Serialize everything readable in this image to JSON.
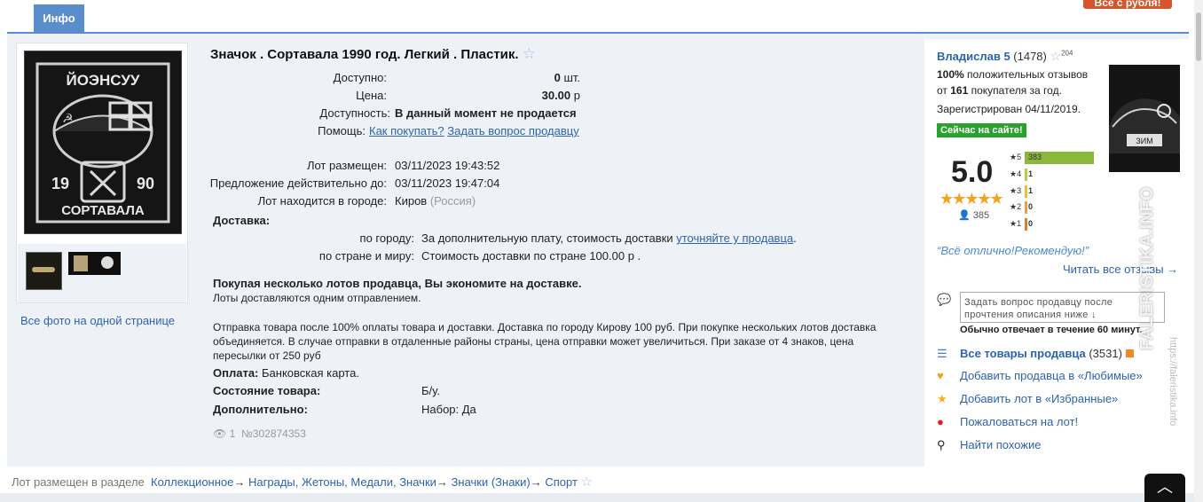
{
  "tab": {
    "label": "Инфо"
  },
  "top_button": {
    "label": "Все с рубля!"
  },
  "lot": {
    "title": "Значок . Сортавала 1990 год. Легкий . Пластик.",
    "image_badge_text": [
      "ЙОЭНСУУ",
      "19",
      "90",
      "СОРТАВАЛА"
    ],
    "all_photos_link": "Все фото на одной странице",
    "fields_top": [
      {
        "label": "Доступно:",
        "value_bold": "0",
        "value_tail": " шт."
      },
      {
        "label": "Цена:",
        "value_bold": "30.00",
        "value_tail": " р"
      }
    ],
    "availability_label": "Доступность:",
    "availability_value": "В данный момент не продается",
    "help_label": "Помощь:",
    "help_link1": "Как покупать?",
    "help_link2": "Задать вопрос продавцу",
    "fields_dates": [
      {
        "label": "Лот размещен:",
        "value": "03/11/2023 19:43:52"
      },
      {
        "label": "Предложение действительно до:",
        "value": "03/11/2023 19:47:04"
      }
    ],
    "city_label": "Лот находится в городе:",
    "city_value": "Киров",
    "city_country": " (Россия)",
    "delivery_heading": "Доставка:",
    "delivery_city_label": "по городу:",
    "delivery_city_text": "За дополнительную плату, стоимость доставки ",
    "delivery_city_link": "уточняйте у продавца",
    "delivery_country_label": "по стране и миру:",
    "delivery_country_text": "Стоимость доставки по стране 100.00 р .",
    "multi_bold": "Покупая несколько лотов продавца, Вы экономите на доставке.",
    "multi_text": "Лоты доставляются одним отправлением.",
    "shipping_note": "Отправка товара после 100% оплаты товара и доставки. Доставка по городу Кирову 100 руб. При покупке нескольких лотов доставка объединяется. В случае отправки в отдаленные районы страны, цена отправки может увеличиться. При заказе от 4 знаков, цена пересылки от 250 руб",
    "payment_label": "Оплата:",
    "payment_value": "Банковская карта.",
    "condition_label": "Состояние товара:",
    "condition_value": "Б/у.",
    "extra_label": "Дополнительно:",
    "extra_value": "Набор: Да",
    "views": "1",
    "lot_number": "№302874353"
  },
  "seller": {
    "name": "Владислав 5",
    "count": " (1478)",
    "stars_sup": "204",
    "positive_pct": "100%",
    "positive_text": " положительных отзывов",
    "buyers_prefix": "от ",
    "buyers_count": "161",
    "buyers_suffix": " покупателя за год.",
    "registered": "Зарегистрирован 04/11/2019.",
    "online": "Сейчас на сайте!",
    "rating": "5.0",
    "rating_stars": "★★★★★",
    "reviews_count": "385",
    "breakdown": [
      {
        "star": "★5",
        "count": "383",
        "fraction": 1.0,
        "color": "#8ab83a"
      },
      {
        "star": "★4",
        "count": "1",
        "fraction": 0.0,
        "color": "#b4cf3c"
      },
      {
        "star": "★3",
        "count": "1",
        "fraction": 0.0,
        "color": "#e6c42e"
      },
      {
        "star": "★2",
        "count": "0",
        "fraction": 0.0,
        "color": "#e9a23b"
      },
      {
        "star": "★1",
        "count": "0",
        "fraction": 0.0,
        "color": "#e07a2e"
      }
    ],
    "quote": "“Всё отлично!Рекомендую!”",
    "read_all": "Читать все отзывы →",
    "ask_placeholder": "Задать вопрос продавцу после прочтения описания ниже ↓",
    "reply_time": "Обычно отвечает в течение 60 минут.",
    "all_items": "Все товары продавца",
    "all_items_count": " (3531)",
    "add_favorite_seller": "Добавить продавца в «Любимые»",
    "add_favorite_lot": "Добавить лот в «Избранные»",
    "complain": "Пожаловаться на лот!",
    "find_similar": "Найти похожие"
  },
  "breadcrumb": {
    "prefix": "Лот размещен в разделе",
    "items": [
      "Коллекционное",
      "Награды, Жетоны, Медали, Значки",
      "Значки (Знаки)",
      "Спорт"
    ]
  },
  "watermark": {
    "main": "FALERISTIKA.INFO",
    "sub": "https://faleristika.info"
  }
}
